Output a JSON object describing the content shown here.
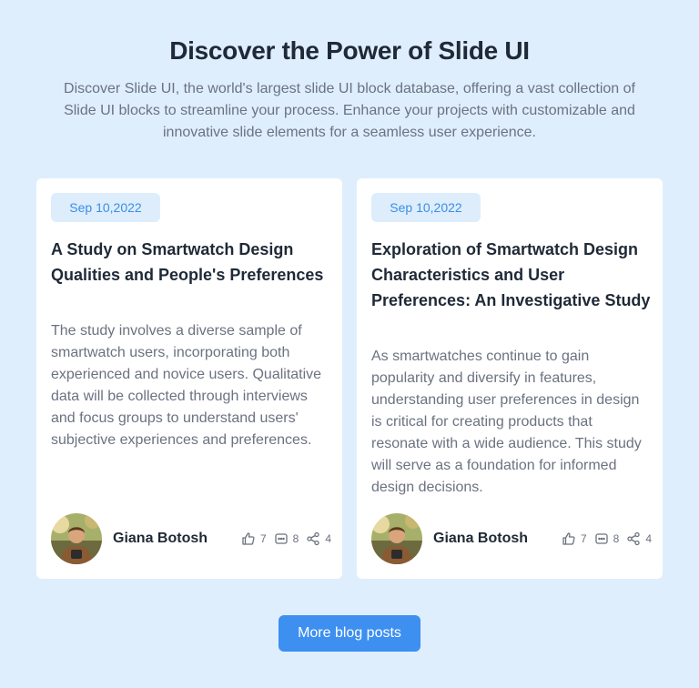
{
  "header": {
    "title": "Discover the Power of Slide UI",
    "description": "Discover Slide UI, the world's largest slide UI block database, offering a vast collection of Slide UI blocks to streamline your process. Enhance your projects with customizable and innovative slide elements for a seamless user experience."
  },
  "cards": [
    {
      "date": "Sep 10,2022",
      "title": "A Study on Smartwatch Design Qualities and People's Preferences",
      "body": "The study involves a diverse sample of smartwatch users, incorporating both experienced and novice users. Qualitative data will be collected through interviews and focus groups to understand users' subjective experiences and preferences.",
      "author": "Giana Botosh",
      "likes": "7",
      "comments": "8",
      "shares": "4"
    },
    {
      "date": "Sep 10,2022",
      "title": "Exploration of Smartwatch Design Characteristics and User Preferences: An Investigative Study",
      "body": "As smartwatches continue to gain popularity and diversify in features, understanding user preferences in design is critical for creating products that resonate with a wide audience. This study will serve as a foundation for informed design decisions.",
      "author": "Giana Botosh",
      "likes": "7",
      "comments": "8",
      "shares": "4"
    }
  ],
  "footer": {
    "button_label": "More blog posts"
  },
  "colors": {
    "background": "#dfeefd",
    "accent": "#3d8ff0",
    "badge_bg": "#deedfb",
    "badge_text": "#3b8ee6"
  },
  "icons": [
    "thumbs-up-icon",
    "comment-icon",
    "share-icon"
  ]
}
